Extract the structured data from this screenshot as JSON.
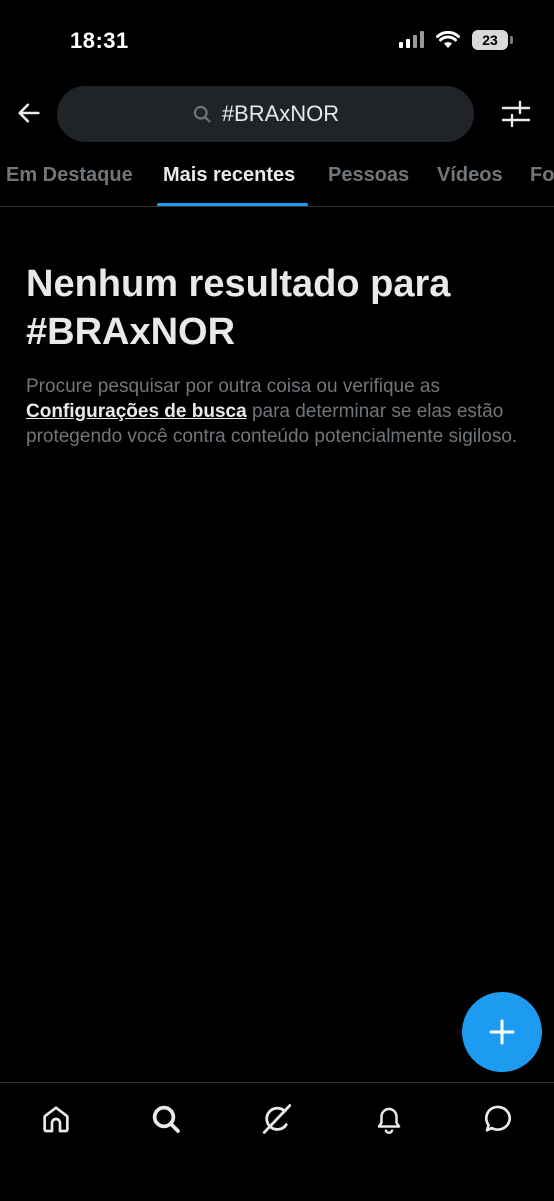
{
  "status_bar": {
    "time": "18:31",
    "battery_level": "23"
  },
  "search": {
    "query": "#BRAxNOR"
  },
  "tabs": [
    {
      "label": "Em Destaque",
      "active": false
    },
    {
      "label": "Mais recentes",
      "active": true
    },
    {
      "label": "Pessoas",
      "active": false
    },
    {
      "label": "Vídeos",
      "active": false
    },
    {
      "label": "Fo",
      "active": false
    }
  ],
  "empty_state": {
    "title_line1": "Nenhum resultado para",
    "title_line2": "#BRAxNOR",
    "body_before": "Procure pesquisar por outra coisa ou verifique as ",
    "body_link": "Configurações de busca",
    "body_after": " para determinar se elas estão protegendo você contra conteúdo potencialmente sigiloso."
  },
  "colors": {
    "accent": "#1d9bf0",
    "background": "#000000",
    "muted_text": "#71767b",
    "search_bg": "#202327"
  },
  "icons": {
    "back": "arrow-left-icon",
    "search": "search-icon",
    "filter": "sliders-icon",
    "compose": "plus-icon",
    "nav": [
      "home-icon",
      "search-icon",
      "grok-icon",
      "bell-icon",
      "message-icon"
    ]
  }
}
